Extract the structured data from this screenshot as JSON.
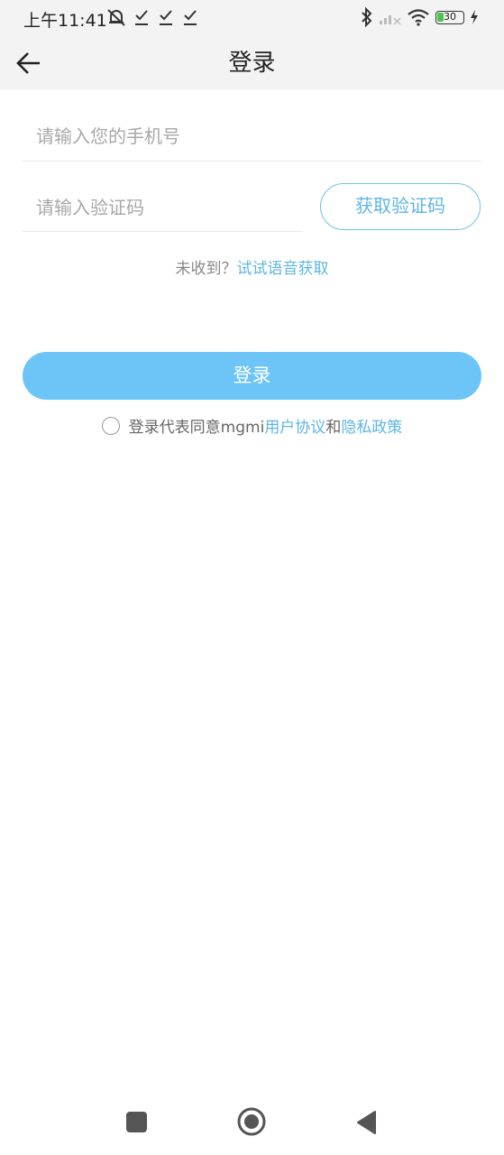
{
  "status_bar": {
    "time": "上午11:41",
    "battery": "30",
    "icons": [
      "alarm-off-icon",
      "download-check-icon",
      "download-check-icon",
      "download-check-icon",
      "bluetooth-icon",
      "signal-icon",
      "wifi-icon",
      "battery-icon",
      "charging-icon"
    ]
  },
  "header": {
    "title": "登录",
    "back_icon": "arrow-left-icon"
  },
  "form": {
    "phone_placeholder": "请输入您的手机号",
    "phone_value": "",
    "code_placeholder": "请输入验证码",
    "code_value": "",
    "get_code_label": "获取验证码",
    "voice_prefix": "未收到？",
    "voice_link": "试试语音获取",
    "login_label": "登录",
    "agree_prefix": "登录代表同意mgmi",
    "agree_user_link": "用户协议",
    "agree_and": "和",
    "agree_privacy_link": "隐私政策",
    "agree_checked": false
  },
  "colors": {
    "accent": "#5db6e3",
    "login_button": "#6dc5f7",
    "header_bg": "#f3f3f3"
  },
  "system_nav": {
    "icons": [
      "recent-apps-icon",
      "home-icon",
      "back-triangle-icon"
    ]
  }
}
